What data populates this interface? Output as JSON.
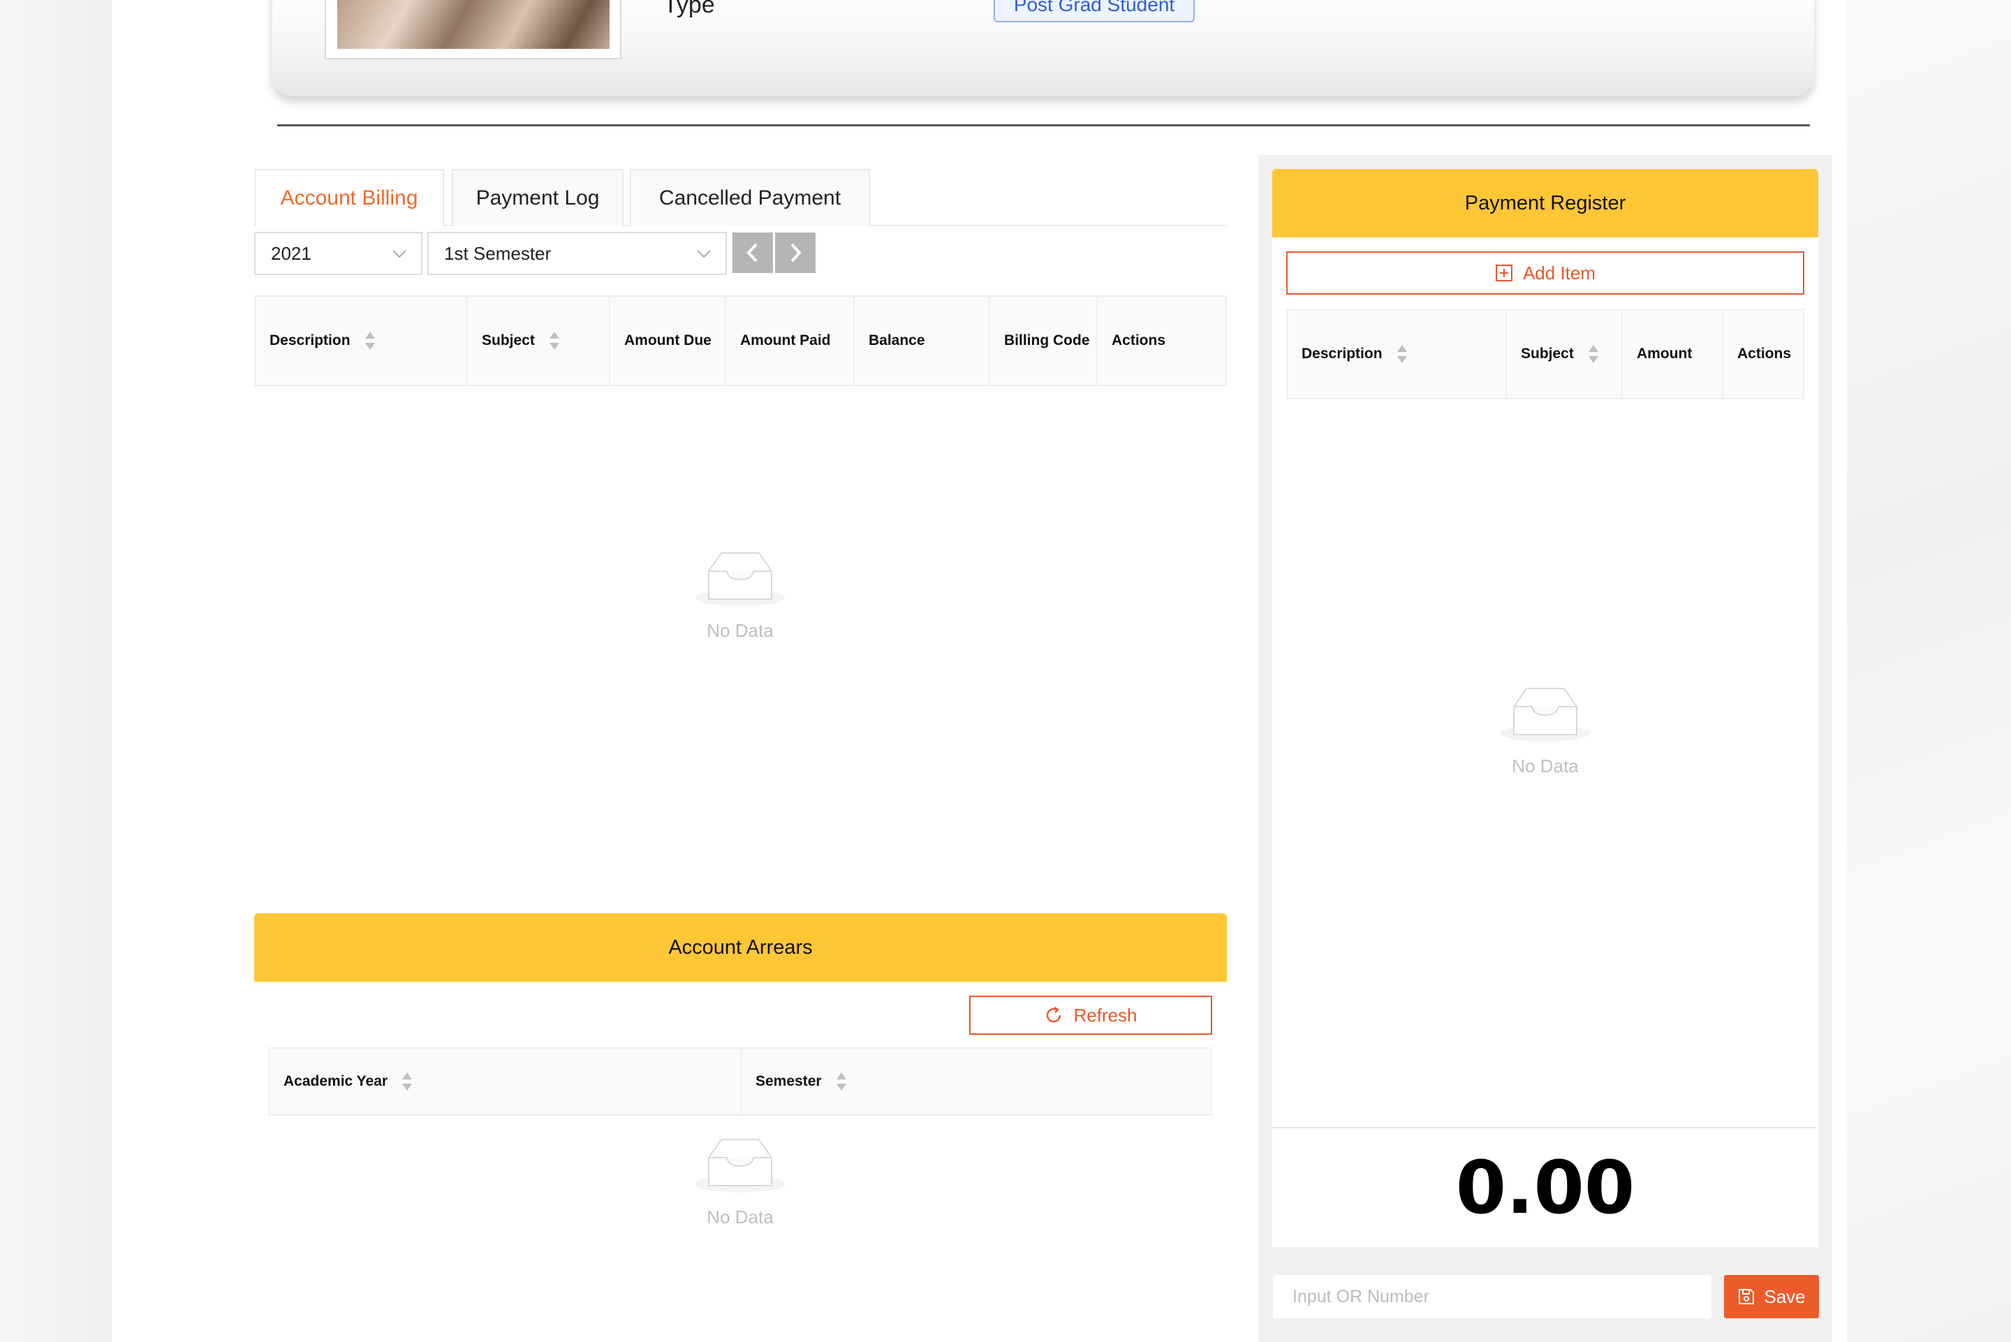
{
  "profile": {
    "type_label": "Type",
    "type_value": "Post Grad Student"
  },
  "tabs": [
    {
      "label": "Account Billing",
      "active": true
    },
    {
      "label": "Payment Log",
      "active": false
    },
    {
      "label": "Cancelled Payment",
      "active": false
    }
  ],
  "filters": {
    "year": "2021",
    "semester": "1st Semester"
  },
  "billing_table": {
    "headers": [
      "Description",
      "Subject",
      "Amount Due",
      "Amount Paid",
      "Balance",
      "Billing Code",
      "Actions"
    ],
    "empty_text": "No Data"
  },
  "arrears": {
    "title": "Account Arrears",
    "refresh_label": "Refresh",
    "headers": [
      "Academic Year",
      "Semester"
    ],
    "empty_text": "No Data"
  },
  "register": {
    "title": "Payment Register",
    "add_item_label": "Add Item",
    "headers": [
      "Description",
      "Subject",
      "Amount",
      "Actions"
    ],
    "empty_text": "No Data",
    "total": "0.00",
    "or_placeholder": "Input OR Number",
    "save_label": "Save"
  },
  "colors": {
    "accent": "#ee6a2a",
    "header_yellow": "#ffc636",
    "badge_blue": "#2f5fd6"
  }
}
